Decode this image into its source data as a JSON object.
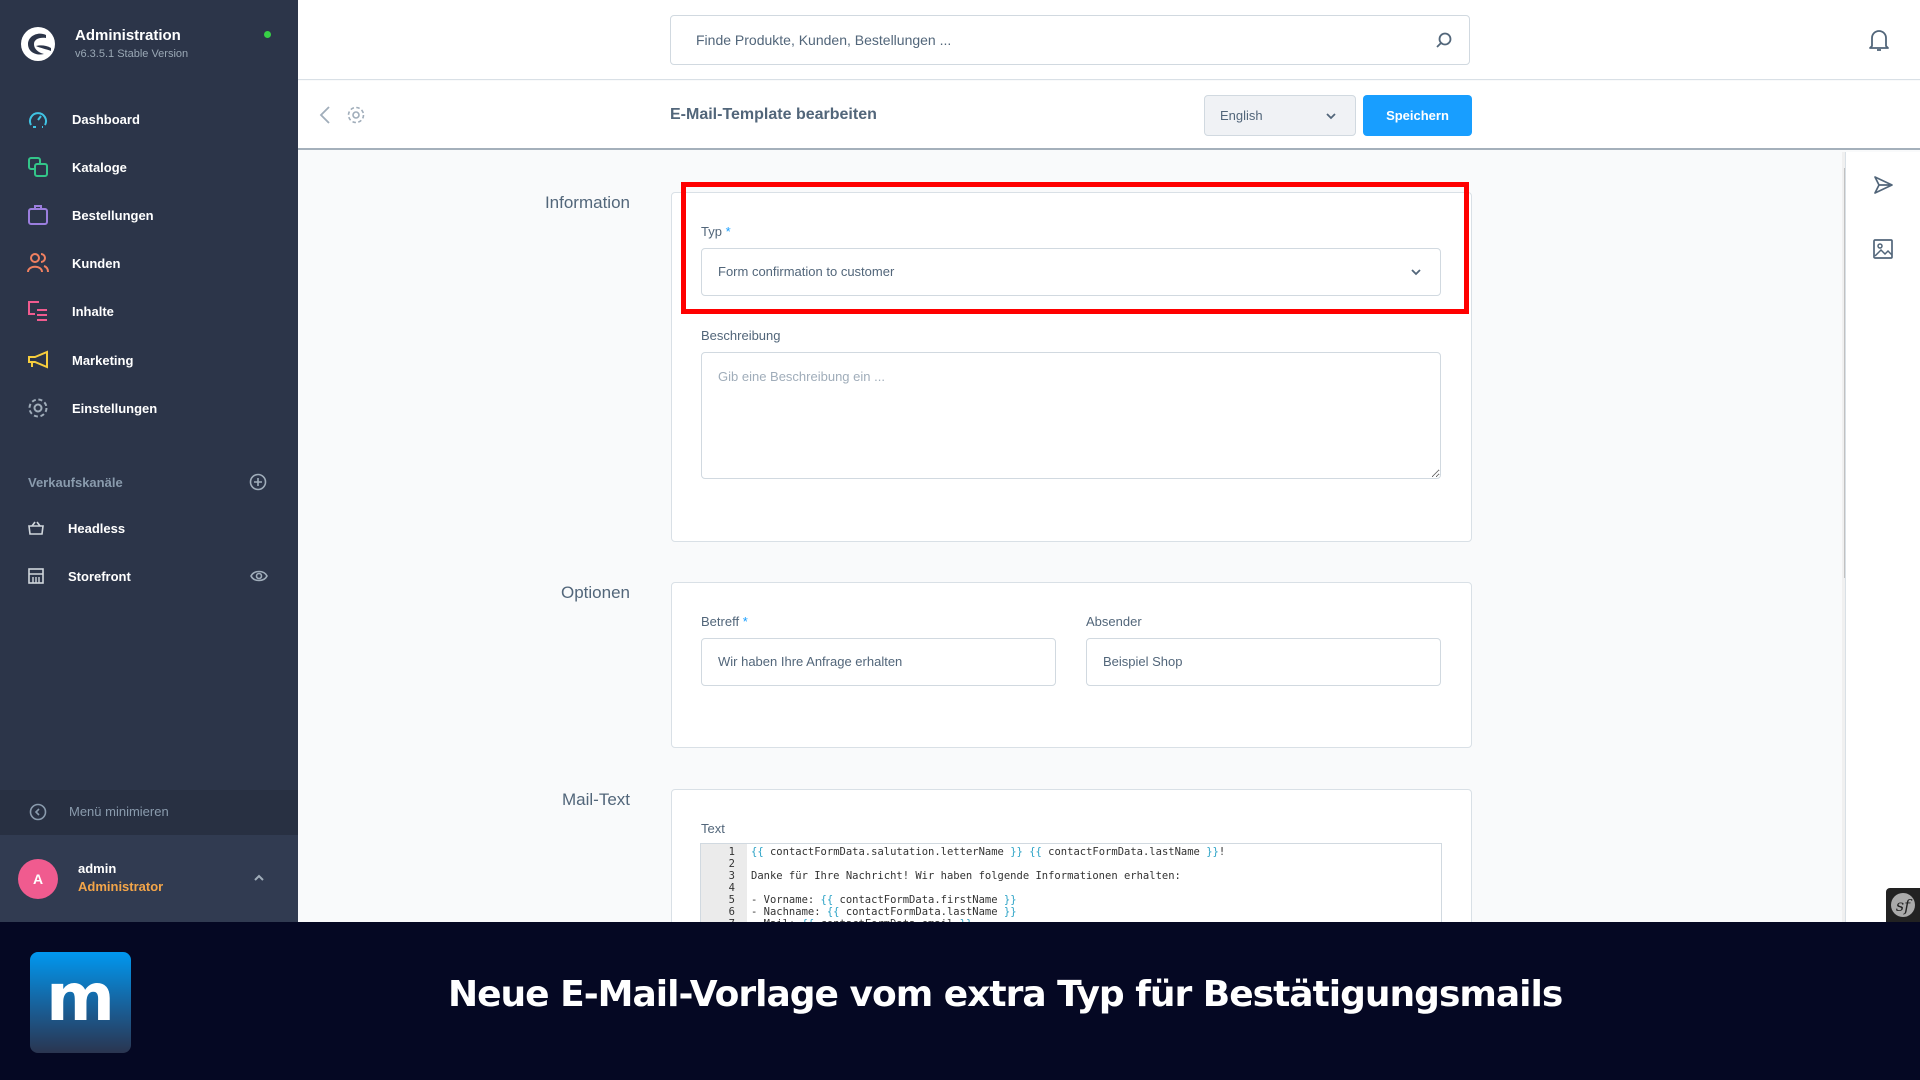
{
  "app": {
    "title": "Administration",
    "version": "v6.3.5.1 Stable Version",
    "status_color": "#37d046"
  },
  "sidebar": {
    "items": [
      {
        "label": "Dashboard",
        "icon": "dashboard-icon",
        "color": "#40c4e4"
      },
      {
        "label": "Kataloge",
        "icon": "catalog-icon",
        "color": "#33c589"
      },
      {
        "label": "Bestellungen",
        "icon": "orders-bag-icon",
        "color": "#9b7ede"
      },
      {
        "label": "Kunden",
        "icon": "customers-icon",
        "color": "#f08060"
      },
      {
        "label": "Inhalte",
        "icon": "content-icon",
        "color": "#f05b8f"
      },
      {
        "label": "Marketing",
        "icon": "megaphone-icon",
        "color": "#f6cd3d"
      },
      {
        "label": "Einstellungen",
        "icon": "gear-icon",
        "color": "#a0adba"
      }
    ],
    "channels_title": "Verkaufskanäle",
    "channels": [
      {
        "label": "Headless",
        "icon": "basket-icon"
      },
      {
        "label": "Storefront",
        "icon": "storefront-icon"
      }
    ],
    "minimize_label": "Menü minimieren",
    "user": {
      "initial": "A",
      "name": "admin",
      "role": "Administrator"
    }
  },
  "topbar": {
    "search_placeholder": "Finde Produkte, Kunden, Bestellungen ..."
  },
  "page_header": {
    "title": "E-Mail-Template bearbeiten",
    "language": "English",
    "save_label": "Speichern"
  },
  "sections": {
    "information": {
      "label": "Information",
      "type_label": "Typ",
      "type_value": "Form confirmation to customer",
      "description_label": "Beschreibung",
      "description_placeholder": "Gib eine Beschreibung ein ..."
    },
    "options": {
      "label": "Optionen",
      "subject_label": "Betreff",
      "subject_value": "Wir haben Ihre Anfrage erhalten",
      "sender_label": "Absender",
      "sender_value": "Beispiel Shop"
    },
    "mail_text": {
      "label": "Mail-Text",
      "text_label": "Text",
      "lines": [
        {
          "n": "1",
          "parts": [
            [
              "t",
              "{{"
            ],
            [
              "p",
              " contactFormData.salutation.letterName "
            ],
            [
              "t",
              "}}"
            ],
            [
              "p",
              " "
            ],
            [
              "t",
              "{{"
            ],
            [
              "p",
              " contactFormData.lastName "
            ],
            [
              "t",
              "}}"
            ],
            [
              "p",
              "!"
            ]
          ]
        },
        {
          "n": "2",
          "parts": []
        },
        {
          "n": "3",
          "parts": [
            [
              "p",
              "Danke für Ihre Nachricht! Wir haben folgende Informationen erhalten:"
            ]
          ]
        },
        {
          "n": "4",
          "parts": []
        },
        {
          "n": "5",
          "parts": [
            [
              "p",
              "- Vorname: "
            ],
            [
              "t",
              "{{"
            ],
            [
              "p",
              " contactFormData.firstName "
            ],
            [
              "t",
              "}}"
            ]
          ]
        },
        {
          "n": "6",
          "parts": [
            [
              "p",
              "- Nachname: "
            ],
            [
              "t",
              "{{"
            ],
            [
              "p",
              " contactFormData.lastName "
            ],
            [
              "t",
              "}}"
            ]
          ]
        },
        {
          "n": "7",
          "parts": [
            [
              "p",
              "- Mail: "
            ],
            [
              "t",
              "{{"
            ],
            [
              "p",
              " contactFormData.email "
            ],
            [
              "t",
              "}}"
            ]
          ]
        }
      ]
    }
  },
  "banner": {
    "logo_letter": "m",
    "title": "Neue E-Mail-Vorlage vom extra Typ für Bestätigungsmails"
  },
  "accent_color": "#189eff",
  "highlight_color": "#ff0000"
}
